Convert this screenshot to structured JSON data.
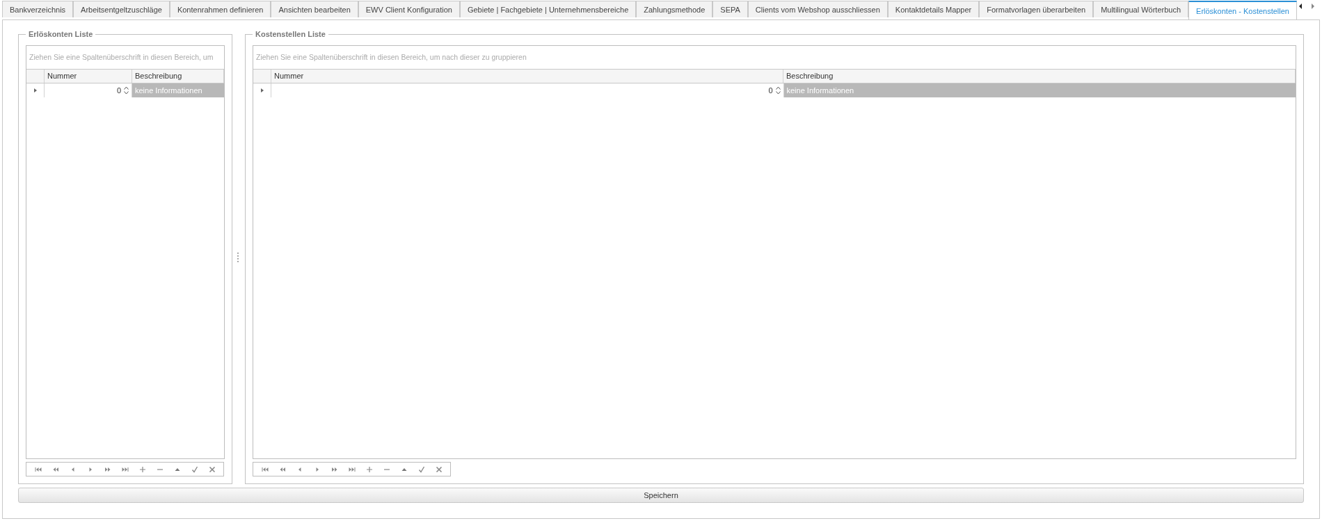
{
  "tabs": [
    {
      "label": "Bankverzeichnis",
      "selected": false
    },
    {
      "label": "Arbeitsentgeltzuschläge",
      "selected": false
    },
    {
      "label": "Kontenrahmen definieren",
      "selected": false
    },
    {
      "label": "Ansichten bearbeiten",
      "selected": false
    },
    {
      "label": "EWV Client Konfiguration",
      "selected": false
    },
    {
      "label": "Gebiete | Fachgebiete | Unternehmensbereiche",
      "selected": false
    },
    {
      "label": "Zahlungsmethode",
      "selected": false
    },
    {
      "label": "SEPA",
      "selected": false
    },
    {
      "label": "Clients vom Webshop ausschliessen",
      "selected": false
    },
    {
      "label": "Kontaktdetails Mapper",
      "selected": false
    },
    {
      "label": "Formatvorlagen überarbeiten",
      "selected": false
    },
    {
      "label": "Multilingual Wörterbuch",
      "selected": false
    },
    {
      "label": "Erlöskonten - Kostenstellen",
      "selected": true
    }
  ],
  "panels": [
    {
      "title": "Erlöskonten Liste",
      "group_hint": "Ziehen Sie eine Spaltenüberschrift in diesen Bereich, um",
      "columns": [
        "Nummer",
        "Beschreibung"
      ],
      "rows": [
        {
          "number": "0",
          "description": "keine Informationen",
          "selected": true
        }
      ]
    },
    {
      "title": "Kostenstellen Liste",
      "group_hint": "Ziehen Sie eine Spaltenüberschrift in diesen Bereich, um nach dieser zu gruppieren",
      "columns": [
        "Nummer",
        "Beschreibung"
      ],
      "rows": [
        {
          "number": "0",
          "description": "keine Informationen",
          "selected": true
        }
      ]
    }
  ],
  "navigator": [
    {
      "kind": "first"
    },
    {
      "kind": "prev-page"
    },
    {
      "kind": "prev"
    },
    {
      "kind": "next"
    },
    {
      "kind": "next-page"
    },
    {
      "kind": "last"
    },
    {
      "kind": "append"
    },
    {
      "kind": "remove"
    },
    {
      "kind": "edit"
    },
    {
      "kind": "save"
    },
    {
      "kind": "cancel"
    }
  ],
  "save_button": "Speichern"
}
